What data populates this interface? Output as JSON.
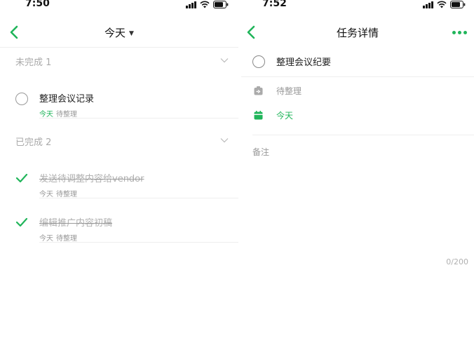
{
  "left": {
    "status": {
      "time": "7:50"
    },
    "nav": {
      "title": "今天"
    },
    "sections": {
      "incomplete": {
        "title": "未完成 1"
      },
      "complete": {
        "title": "已完成 2"
      }
    },
    "tasks_incomplete": [
      {
        "title": "整理会议记录",
        "date": "今天",
        "list": "待整理"
      }
    ],
    "tasks_complete": [
      {
        "title": "发送待调整内容给vendor",
        "date": "今天",
        "list": "待整理"
      },
      {
        "title": "编辑推广内容初稿",
        "date": "今天",
        "list": "待整理"
      }
    ]
  },
  "right": {
    "status": {
      "time": "7:52"
    },
    "nav": {
      "title": "任务详情"
    },
    "task": {
      "title": "整理会议纪要"
    },
    "list": {
      "label": "待整理"
    },
    "date": {
      "label": "今天"
    },
    "notes": {
      "label": "备注",
      "counter": "0/200"
    }
  },
  "colors": {
    "accent": "#20b55a",
    "muted": "#999999",
    "divider": "#eeeeee"
  },
  "icons": [
    "signal-icon",
    "wifi-icon",
    "battery-icon",
    "back-arrow-icon",
    "caret-down-icon",
    "chevron-down-icon",
    "checkmark-icon",
    "more-icon",
    "list-inbox-icon",
    "calendar-icon"
  ]
}
